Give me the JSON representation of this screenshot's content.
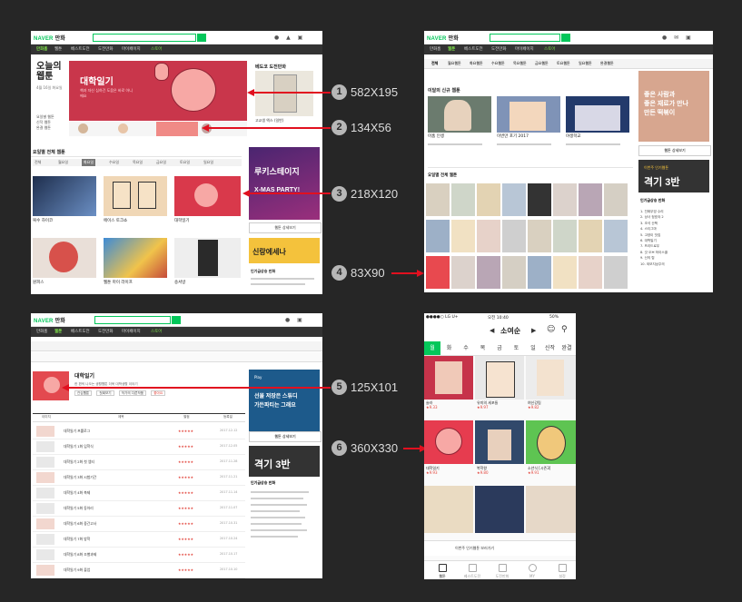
{
  "naver": {
    "logo": "NAVER",
    "service": "만화",
    "search_placeholder": "웹툰, 작가명, 도서명",
    "search_btn": "검색"
  },
  "nav": {
    "items": [
      "만화홈",
      "웹툰",
      "베스트도전",
      "도전만화",
      "마이페이지"
    ],
    "extra": [
      "스토어",
      "만화광장",
      "업로드"
    ]
  },
  "panel1": {
    "left_title": "오늘의 웹툰",
    "left_sub": "4월 16일 화요일",
    "left_links": [
      "요일별 웹툰",
      "신작 웹툰",
      "완결 웹툰"
    ],
    "banner_title": "대학일기",
    "banner_sub": "책과 자신 심하긴 \n도움은 바로 아니에요",
    "sidebar_head": "베도코 도전만화",
    "sidebar_sub": "고교생 엑스 (일반)",
    "section_title": "요일별 전체 웹툰",
    "filters": [
      "전체",
      "월요일",
      "화요일",
      "수요일",
      "목요일",
      "금요일",
      "토요일",
      "일요일"
    ],
    "ad_title": "루키스테이지",
    "ad_line2": "X-MAS PARTY!",
    "ad_btn": "웹툰 상세보기",
    "sidebar2_title": "신랑에세나",
    "rank_head": "인기급상승 만화",
    "thumb_titles": [
      "복수 하이코",
      "에이스 토크쇼",
      "대학일기",
      "원피스",
      "웹툰 마이 라이프",
      "송서방"
    ],
    "thumb_sub": [
      "진행",
      "연재",
      "완결"
    ]
  },
  "panel2": {
    "tabs": [
      "전체",
      "월요웹툰",
      "화요웹툰",
      "수요웹툰",
      "목요웹툰",
      "금요웹툰",
      "토요웹툰",
      "일요웹툰",
      "완결웹툰"
    ],
    "section_title": "이달의 신규 웹툰",
    "items": [
      {
        "title": "아홉 인생",
        "sub": "작가"
      },
      {
        "title": "이번만 포기 2017",
        "sub": "작가"
      },
      {
        "title": "야생학교",
        "sub": "작가"
      }
    ],
    "ad_lines": [
      "좋은 사람과",
      "좋은 재료가 만나",
      "만든 떡볶이"
    ],
    "ad_btn": "웹툰 상세보기",
    "promo_small": "이번주 인기웹툰",
    "promo_big": "격기 3반",
    "grid_title": "요일별 전체 웹툰",
    "rank_head": "인기급상승 만화",
    "rank_items": [
      "1. 진짜무빙 수리",
      "2. 상사 정호야 2",
      "3. 조석 산책",
      "4. 스티그마",
      "5. 고양이 맛집",
      "6. 대학일기",
      "7. 프리드로우",
      "8. 갓 오브 하이스쿨",
      "9. 신의 탑",
      "10. 외모지상주의"
    ]
  },
  "panel3": {
    "title": "대학일기",
    "desc": "한 편씩 나오는 생활웹툰 더욱 대학생활 이야기",
    "tags": [
      "관심웹툰",
      "첫회보기",
      "작가의 다른작품",
      "좋아요"
    ],
    "columns": [
      "이미지",
      "제목",
      "별점",
      "등록일"
    ],
    "episodes": [
      "대학일기 프롤로그",
      "대학일기 1화 입학식",
      "대학일기 2화 첫 엠티",
      "대학일기 3화 시험기간",
      "대학일기 4화 축제",
      "대학일기 5화 동아리",
      "대학일기 6화 중간고사",
      "대학일기 7화 방학",
      "대학일기 8화 조별과제",
      "대학일기 9화 졸업"
    ],
    "dates": [
      "2017.12.12",
      "2017.12.05",
      "2017.11.28",
      "2017.11.21",
      "2017.11.14",
      "2017.11.07",
      "2017.10.31",
      "2017.10.24",
      "2017.10.17",
      "2017.10.10"
    ],
    "ad_top": "Play",
    "ad_line1": "선물 저장은 스튜디",
    "ad_line2": "가든파티는 그래요",
    "ad_btn": "웹툰 상세보기",
    "promo": "격기 3반",
    "rank_head": "인기급상승 만화"
  },
  "mobile": {
    "carrier": "●●●●○ LG U+",
    "time": "오전 10:40",
    "battery": "50%",
    "title": "소여순",
    "days": [
      "월",
      "화",
      "수",
      "목",
      "금",
      "토",
      "일",
      "신작",
      "완결"
    ],
    "items": [
      {
        "title": "슬라 ",
        "rate": "★9.33"
      },
      {
        "title": "유미의 세포들",
        "rate": "★9.97"
      },
      {
        "title": "여신강림",
        "rate": "★9.82"
      },
      {
        "title": "대학일기",
        "rate": "★9.93"
      },
      {
        "title": "복학왕",
        "rate": "★9.80"
      },
      {
        "title": "소년식 [시즌3]",
        "rate": "★9.91"
      }
    ],
    "bottom_nav": [
      "웹툰",
      "베스트도전",
      "도전만화",
      "MY",
      "설정"
    ],
    "ad_text": "이번주 인기웹툰 보러가기"
  },
  "annotations": [
    {
      "num": "1",
      "label": "582X195"
    },
    {
      "num": "2",
      "label": "134X56"
    },
    {
      "num": "3",
      "label": "218X120"
    },
    {
      "num": "4",
      "label": "83X90"
    },
    {
      "num": "5",
      "label": "125X101"
    },
    {
      "num": "6",
      "label": "360X330"
    }
  ]
}
